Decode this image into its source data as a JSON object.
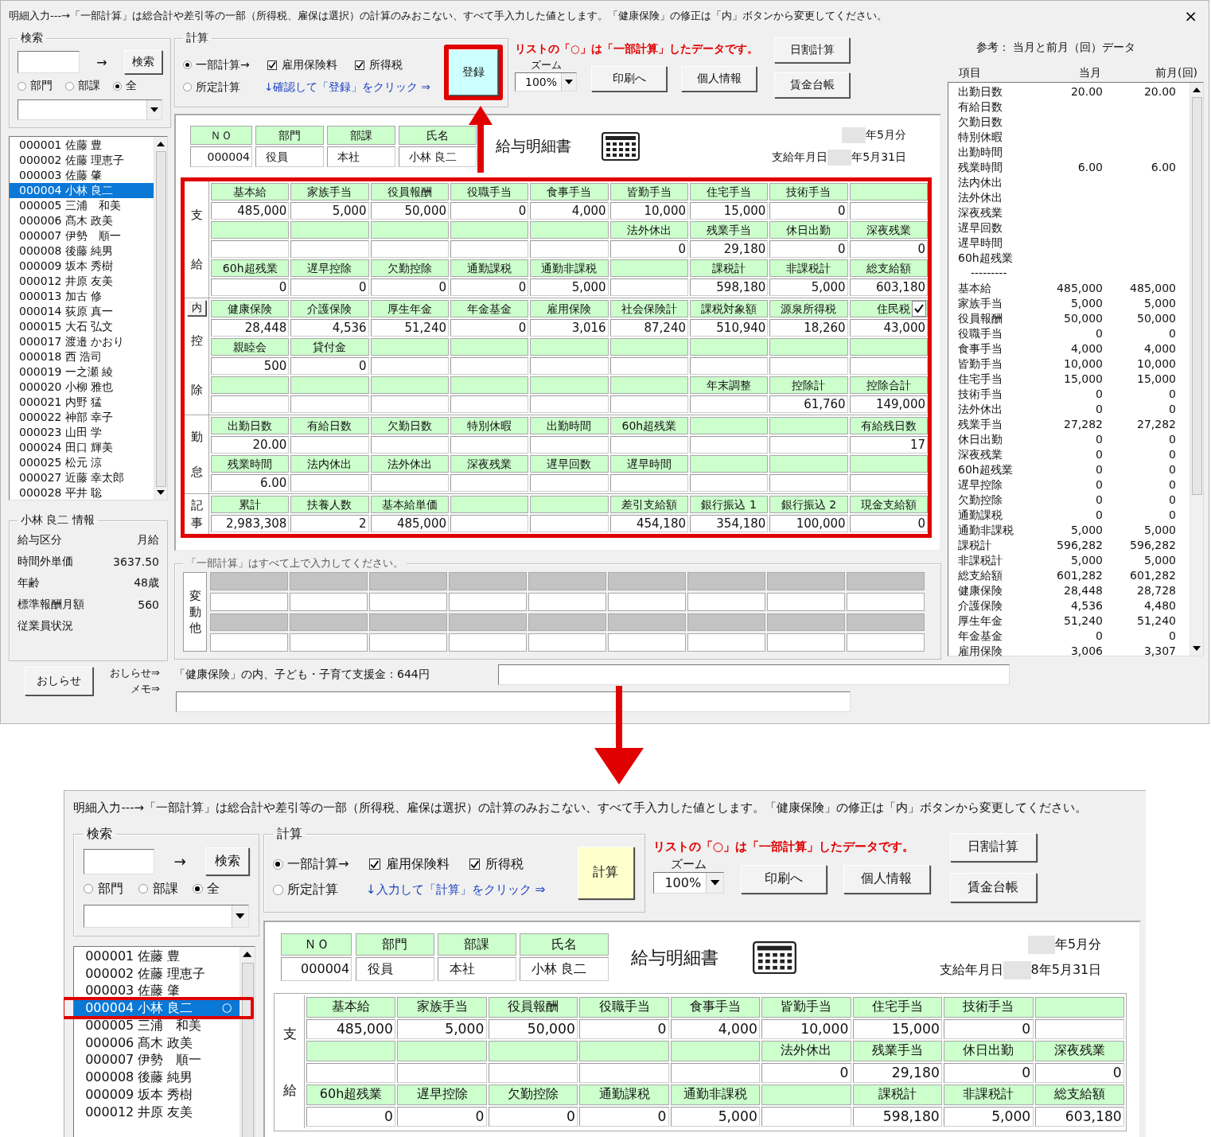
{
  "screens": [
    {
      "kind": "full",
      "title": "明細入力---→「一部計算」は総合計や差引等の一部（所得税、雇保は選択）の計算のみおこない、すべて手入力した値とします。「健康保険」の修正は「内」ボタンから変更してください。",
      "close": "×",
      "search": {
        "legend": "検索",
        "arrow": "→",
        "button": "検索",
        "radios": [
          {
            "label": "部門",
            "selected": false
          },
          {
            "label": "部課",
            "selected": false
          },
          {
            "label": "全",
            "selected": true
          }
        ]
      },
      "employees": [
        {
          "label": "000001 佐藤 豊",
          "selected": false,
          "highlighted": false
        },
        {
          "label": "000002 佐藤 理恵子",
          "selected": false,
          "highlighted": false
        },
        {
          "label": "000003 佐藤 肇",
          "selected": false,
          "highlighted": false
        },
        {
          "label": "000004 小林 良二",
          "selected": true,
          "highlighted": false
        },
        {
          "label": "000005 三浦　和美",
          "selected": false,
          "highlighted": false
        },
        {
          "label": "000006 髙木 政美",
          "selected": false,
          "highlighted": false
        },
        {
          "label": "000007 伊勢　順一",
          "selected": false,
          "highlighted": false
        },
        {
          "label": "000008 後藤 純男",
          "selected": false,
          "highlighted": false
        },
        {
          "label": "000009 坂本 秀樹",
          "selected": false,
          "highlighted": false
        },
        {
          "label": "000012 井原 友美",
          "selected": false,
          "highlighted": false
        },
        {
          "label": "000013 加古 修",
          "selected": false,
          "highlighted": false
        },
        {
          "label": "000014 荻原 真一",
          "selected": false,
          "highlighted": false
        },
        {
          "label": "000015 大石 弘文",
          "selected": false,
          "highlighted": false
        },
        {
          "label": "000017 渡邉 かおり",
          "selected": false,
          "highlighted": false
        },
        {
          "label": "000018 西 浩司",
          "selected": false,
          "highlighted": false
        },
        {
          "label": "000019 一之瀬 綾",
          "selected": false,
          "highlighted": false
        },
        {
          "label": "000020 小柳 雅也",
          "selected": false,
          "highlighted": false
        },
        {
          "label": "000021 内野 猛",
          "selected": false,
          "highlighted": false
        },
        {
          "label": "000022 神部 幸子",
          "selected": false,
          "highlighted": false
        },
        {
          "label": "000023 山田 学",
          "selected": false,
          "highlighted": false
        },
        {
          "label": "000024 田口 輝美",
          "selected": false,
          "highlighted": false
        },
        {
          "label": "000025 松元 涼",
          "selected": false,
          "highlighted": false
        },
        {
          "label": "000027 近藤 幸太郎",
          "selected": false,
          "highlighted": false
        },
        {
          "label": "000028 平井 聡",
          "selected": false,
          "highlighted": false
        }
      ],
      "info": {
        "legend": "小林 良二 情報",
        "rows": [
          {
            "label": "給与区分",
            "value": "月給"
          },
          {
            "label": "時間外単価",
            "value": "3637.50"
          },
          {
            "label": "年齢",
            "value": "48歳"
          },
          {
            "label": "標準報酬月額",
            "value": "560"
          },
          {
            "label": "従業員状況"
          }
        ],
        "button": "おしらせ",
        "links": [
          "おしらせ⇒",
          "メモ⇒"
        ]
      },
      "calc": {
        "legend": "計算",
        "modes": [
          {
            "label": "一部計算→",
            "selected": true
          },
          {
            "label": "所定計算",
            "selected": false
          }
        ],
        "checks": [
          {
            "label": "雇用保険料",
            "checked": true
          },
          {
            "label": "所得税",
            "checked": true
          }
        ],
        "hint": "↓確認して「登録」をクリック ⇒",
        "button": {
          "label": "登録",
          "kind": "register",
          "highlighted": true
        }
      },
      "note": "リストの「○」は「一部計算」したデータです。",
      "zoom": {
        "label": "ズーム",
        "value": "100%"
      },
      "action_buttons": [
        "印刷へ",
        "個人情報"
      ],
      "side_buttons": [
        "日割計算",
        "賃金台帳"
      ],
      "payslip": {
        "highlighted": true,
        "header_columns": [
          "ＮＯ",
          "部門",
          "部課",
          "氏名"
        ],
        "header_values": [
          "000004",
          "役員",
          "本社",
          "小林 良二"
        ],
        "title": "給与明細書",
        "period": "年5月分",
        "pay_date_label": "支給年月日",
        "pay_date": "年5月31日",
        "sections": [
          {
            "label": "支給",
            "rows": [
              {
                "heads": {
                  "column_1": "基本給",
                  "column_2": "家族手当",
                  "column_3": "役員報酬",
                  "column_4": "役職手当",
                  "column_5": "食事手当",
                  "column_6": "皆勤手当",
                  "column_7": "住宅手当",
                  "column_8": "技術手当"
                },
                "values": {
                  "column_1": "485,000",
                  "column_2": "5,000",
                  "column_3": "50,000",
                  "column_4": "0",
                  "column_5": "4,000",
                  "column_6": "10,000",
                  "column_7": "15,000",
                  "column_8": "0"
                }
              },
              {
                "heads": {
                  "column_6": "法外休出",
                  "column_7": "残業手当",
                  "column_8": "休日出勤",
                  "column_9": "深夜残業"
                },
                "values": {
                  "column_6": "0",
                  "column_7": "29,180",
                  "column_8": "0",
                  "column_9": "0"
                }
              },
              {
                "heads": {
                  "column_1": "60h超残業",
                  "column_2": "遅早控除",
                  "column_3": "欠勤控除",
                  "column_4": "通勤課税",
                  "column_5": "通勤非課税",
                  "column_7": "課税計",
                  "column_8": "非課税計",
                  "column_9": "総支給額"
                },
                "values": {
                  "column_1": "0",
                  "column_2": "0",
                  "column_3": "0",
                  "column_4": "0",
                  "column_5": "5,000",
                  "column_7": "598,180",
                  "column_8": "5,000",
                  "column_9": "603,180"
                }
              }
            ]
          },
          {
            "label": "控除",
            "button": "内",
            "rows": [
              {
                "heads": {
                  "column_1": "健康保険",
                  "column_2": "介護保険",
                  "column_3": "厚生年金",
                  "column_4": "年金基金",
                  "column_5": "雇用保険",
                  "column_6": "社会保険計",
                  "column_7": "課税対象額",
                  "column_8": "源泉所得税",
                  "column_9": "住民税"
                },
                "toggles": {
                  "column_9": true
                },
                "values": {
                  "column_1": "28,448",
                  "column_2": "4,536",
                  "column_3": "51,240",
                  "column_4": "0",
                  "column_5": "3,016",
                  "column_6": "87,240",
                  "column_7": "510,940",
                  "column_8": "18,260",
                  "column_9": "43,000"
                }
              },
              {
                "heads": {
                  "column_1": "親睦会",
                  "column_2": "貸付金"
                },
                "values": {
                  "column_1": "500",
                  "column_2": "0"
                }
              },
              {
                "heads": {
                  "column_7": "年末調整",
                  "column_8": "控除計",
                  "column_9": "控除合計"
                },
                "values": {
                  "column_8": "61,760",
                  "column_9": "149,000"
                }
              }
            ]
          },
          {
            "label": "勤怠",
            "rows": [
              {
                "heads": {
                  "column_1": "出勤日数",
                  "column_2": "有給日数",
                  "column_3": "欠勤日数",
                  "column_4": "特別休暇",
                  "column_5": "出勤時間",
                  "column_6": "60h超残業",
                  "column_9": "有給残日数"
                },
                "values": {
                  "column_1": "20.00",
                  "column_9": "17"
                }
              },
              {
                "heads": {
                  "column_1": "残業時間",
                  "column_2": "法内休出",
                  "column_3": "法外休出",
                  "column_4": "深夜残業",
                  "column_5": "遅早回数",
                  "column_6": "遅早時間"
                },
                "values": {
                  "column_1": "6.00"
                }
              }
            ]
          },
          {
            "label": "記事",
            "rows": [
              {
                "heads": {
                  "column_1": "累計",
                  "column_2": "扶養人数",
                  "column_3": "基本給単価",
                  "column_6": "差引支給額",
                  "column_7": "銀行振込 1",
                  "column_8": "銀行振込 2",
                  "column_9": "現金支給額"
                },
                "values": {
                  "column_1": "2,983,308",
                  "column_2": "2",
                  "column_3": "485,000",
                  "column_6": "454,180",
                  "column_7": "354,180",
                  "column_8": "100,000",
                  "column_9": "0"
                }
              }
            ]
          }
        ]
      },
      "changes": {
        "legend": "「一部計算」はすべて上で入力してください。",
        "label": "変動他"
      },
      "footer": {
        "text": "「健康保険」の内、子ども・子育て支援金：644円"
      },
      "reference": {
        "title": "参考： 当月と前月（回）データ",
        "columns": [
          "項目",
          "当月",
          "前月(回)"
        ],
        "rows": [
          {
            "kind": "row",
            "label": "出勤日数",
            "current": "20.00",
            "previous": "20.00"
          },
          {
            "kind": "row",
            "label": "有給日数"
          },
          {
            "kind": "row",
            "label": "欠勤日数"
          },
          {
            "kind": "row",
            "label": "特別休暇"
          },
          {
            "kind": "row",
            "label": "出勤時間"
          },
          {
            "kind": "row",
            "label": "残業時間",
            "current": "6.00",
            "previous": "6.00"
          },
          {
            "kind": "row",
            "label": "法内休出"
          },
          {
            "kind": "row",
            "label": "法外休出"
          },
          {
            "kind": "row",
            "label": "深夜残業"
          },
          {
            "kind": "row",
            "label": "遅早回数"
          },
          {
            "kind": "row",
            "label": "遅早時間"
          },
          {
            "kind": "row",
            "label": "60h超残業"
          },
          {
            "kind": "separator",
            "label": "---------"
          },
          {
            "kind": "row",
            "label": "基本給",
            "current": "485,000",
            "previous": "485,000"
          },
          {
            "kind": "row",
            "label": "家族手当",
            "current": "5,000",
            "previous": "5,000"
          },
          {
            "kind": "row",
            "label": "役員報酬",
            "current": "50,000",
            "previous": "50,000"
          },
          {
            "kind": "row",
            "label": "役職手当",
            "current": "0",
            "previous": "0"
          },
          {
            "kind": "row",
            "label": "食事手当",
            "current": "4,000",
            "previous": "4,000"
          },
          {
            "kind": "row",
            "label": "皆勤手当",
            "current": "10,000",
            "previous": "10,000"
          },
          {
            "kind": "row",
            "label": "住宅手当",
            "current": "15,000",
            "previous": "15,000"
          },
          {
            "kind": "row",
            "label": "技術手当",
            "current": "0",
            "previous": "0"
          },
          {
            "kind": "row",
            "label": "法外休出",
            "current": "0",
            "previous": "0"
          },
          {
            "kind": "row",
            "label": "残業手当",
            "current": "27,282",
            "previous": "27,282"
          },
          {
            "kind": "row",
            "label": "休日出勤",
            "current": "0",
            "previous": "0"
          },
          {
            "kind": "row",
            "label": "深夜残業",
            "current": "0",
            "previous": "0"
          },
          {
            "kind": "row",
            "label": "60h超残業",
            "current": "0",
            "previous": "0"
          },
          {
            "kind": "row",
            "label": "遅早控除",
            "current": "0",
            "previous": "0"
          },
          {
            "kind": "row",
            "label": "欠勤控除",
            "current": "0",
            "previous": "0"
          },
          {
            "kind": "row",
            "label": "通勤課税",
            "current": "0",
            "previous": "0"
          },
          {
            "kind": "row",
            "label": "通勤非課税",
            "current": "5,000",
            "previous": "5,000"
          },
          {
            "kind": "row",
            "label": "課税計",
            "current": "596,282",
            "previous": "596,282"
          },
          {
            "kind": "row",
            "label": "非課税計",
            "current": "5,000",
            "previous": "5,000"
          },
          {
            "kind": "row",
            "label": "総支給額",
            "current": "601,282",
            "previous": "601,282"
          },
          {
            "kind": "row",
            "label": "健康保険",
            "current": "28,448",
            "previous": "28,728"
          },
          {
            "kind": "row",
            "label": "介護保険",
            "current": "4,536",
            "previous": "4,480"
          },
          {
            "kind": "row",
            "label": "厚生年金",
            "current": "51,240",
            "previous": "51,240"
          },
          {
            "kind": "row",
            "label": "年金基金",
            "current": "0",
            "previous": "0"
          },
          {
            "kind": "row",
            "label": "雇用保険",
            "current": "3,006",
            "previous": "3,307"
          }
        ]
      }
    },
    {
      "kind": "crop",
      "title": "明細入力---→「一部計算」は総合計や差引等の一部（所得税、雇保は選択）の計算のみおこない、すべて手入力した値とします。「健康保険」の修正は「内」ボタンから変更してください。",
      "search": {
        "legend": "検索",
        "arrow": "→",
        "button": "検索",
        "radios": [
          {
            "label": "部門",
            "selected": false
          },
          {
            "label": "部課",
            "selected": false
          },
          {
            "label": "全",
            "selected": true
          }
        ]
      },
      "employees": [
        {
          "label": "000001 佐藤 豊",
          "selected": false,
          "highlighted": false
        },
        {
          "label": "000002 佐藤 理恵子",
          "selected": false,
          "highlighted": false
        },
        {
          "label": "000003 佐藤 肇",
          "selected": false,
          "highlighted": false
        },
        {
          "label": "000004 小林 良二",
          "selected": true,
          "highlighted": true,
          "mark": "○"
        },
        {
          "label": "000005 三浦　和美",
          "selected": false,
          "highlighted": false
        },
        {
          "label": "000006 髙木 政美",
          "selected": false,
          "highlighted": false
        },
        {
          "label": "000007 伊勢　順一",
          "selected": false,
          "highlighted": false
        },
        {
          "label": "000008 後藤 純男",
          "selected": false,
          "highlighted": false
        },
        {
          "label": "000009 坂本 秀樹",
          "selected": false,
          "highlighted": false
        },
        {
          "label": "000012 井原 友美",
          "selected": false,
          "highlighted": false
        }
      ],
      "calc": {
        "legend": "計算",
        "modes": [
          {
            "label": "一部計算→",
            "selected": true
          },
          {
            "label": "所定計算",
            "selected": false
          }
        ],
        "checks": [
          {
            "label": "雇用保険料",
            "checked": true
          },
          {
            "label": "所得税",
            "checked": true
          }
        ],
        "hint": "↓入力して「計算」をクリック ⇒",
        "button": {
          "label": "計算",
          "kind": "calculate",
          "highlighted": false
        }
      },
      "note": "リストの「○」は「一部計算」したデータです。",
      "zoom": {
        "label": "ズーム",
        "value": "100%"
      },
      "action_buttons": [
        "印刷へ",
        "個人情報"
      ],
      "side_buttons": [
        "日割計算",
        "賃金台帳"
      ],
      "payslip": {
        "highlighted": false,
        "header_columns": [
          "ＮＯ",
          "部門",
          "部課",
          "氏名"
        ],
        "header_values": [
          "000004",
          "役員",
          "本社",
          "小林 良二"
        ],
        "title": "給与明細書",
        "period": "年5月分",
        "pay_date_label": "支給年月日",
        "pay_date": "8年5月31日",
        "sections": [
          {
            "label": "支給",
            "rows": [
              {
                "heads": {
                  "column_1": "基本給",
                  "column_2": "家族手当",
                  "column_3": "役員報酬",
                  "column_4": "役職手当",
                  "column_5": "食事手当",
                  "column_6": "皆勤手当",
                  "column_7": "住宅手当",
                  "column_8": "技術手当"
                },
                "values": {
                  "column_1": "485,000",
                  "column_2": "5,000",
                  "column_3": "50,000",
                  "column_4": "0",
                  "column_5": "4,000",
                  "column_6": "10,000",
                  "column_7": "15,000",
                  "column_8": "0"
                }
              },
              {
                "heads": {
                  "column_6": "法外休出",
                  "column_7": "残業手当",
                  "column_8": "休日出勤",
                  "column_9": "深夜残業"
                },
                "values": {
                  "column_6": "0",
                  "column_7": "29,180",
                  "column_8": "0",
                  "column_9": "0"
                }
              },
              {
                "heads": {
                  "column_1": "60h超残業",
                  "column_2": "遅早控除",
                  "column_3": "欠勤控除",
                  "column_4": "通勤課税",
                  "column_5": "通勤非課税",
                  "column_7": "課税計",
                  "column_8": "非課税計",
                  "column_9": "総支給額"
                },
                "values": {
                  "column_1": "0",
                  "column_2": "0",
                  "column_3": "0",
                  "column_4": "0",
                  "column_5": "5,000",
                  "column_7": "598,180",
                  "column_8": "5,000",
                  "column_9": "603,180"
                }
              }
            ]
          }
        ]
      }
    }
  ]
}
